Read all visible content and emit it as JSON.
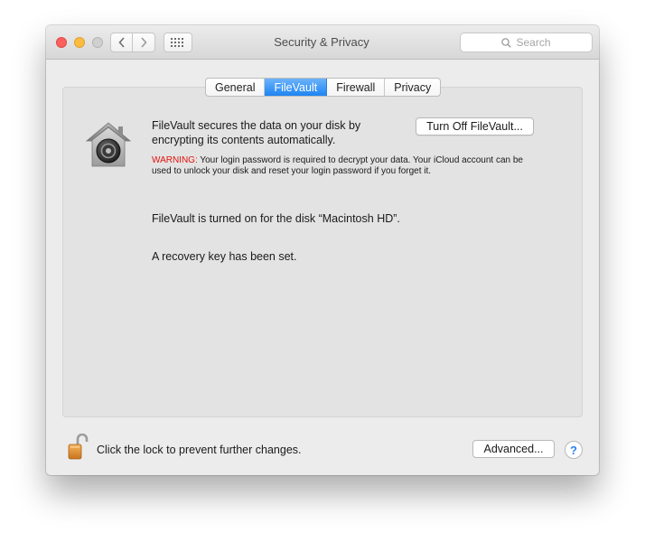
{
  "window": {
    "title": "Security & Privacy"
  },
  "toolbar": {
    "search_placeholder": "Search",
    "back_icon": "chevron-left-icon",
    "forward_icon": "chevron-right-icon",
    "show_all_icon": "grid-icon"
  },
  "tabs": [
    {
      "label": "General",
      "active": false
    },
    {
      "label": "FileVault",
      "active": true
    },
    {
      "label": "Firewall",
      "active": false
    },
    {
      "label": "Privacy",
      "active": false
    }
  ],
  "filevault": {
    "description": "FileVault secures the data on your disk by encrypting its contents automatically.",
    "turn_off_label": "Turn Off FileVault...",
    "warning_prefix": "WARNING:",
    "warning_text": " Your login password is required to decrypt your data. Your iCloud account can be used to unlock your disk and reset your login password if you forget it.",
    "status_disk": "FileVault is turned on for the disk “Macintosh HD”.",
    "status_recovery": "A recovery key has been set."
  },
  "footer": {
    "lock_message": "Click the lock to prevent further changes.",
    "advanced_label": "Advanced...",
    "help_label": "?"
  },
  "colors": {
    "accent": "#1e84f2",
    "warning": "#e0140c",
    "close": "#fc605c",
    "minimize": "#fdbc40"
  }
}
